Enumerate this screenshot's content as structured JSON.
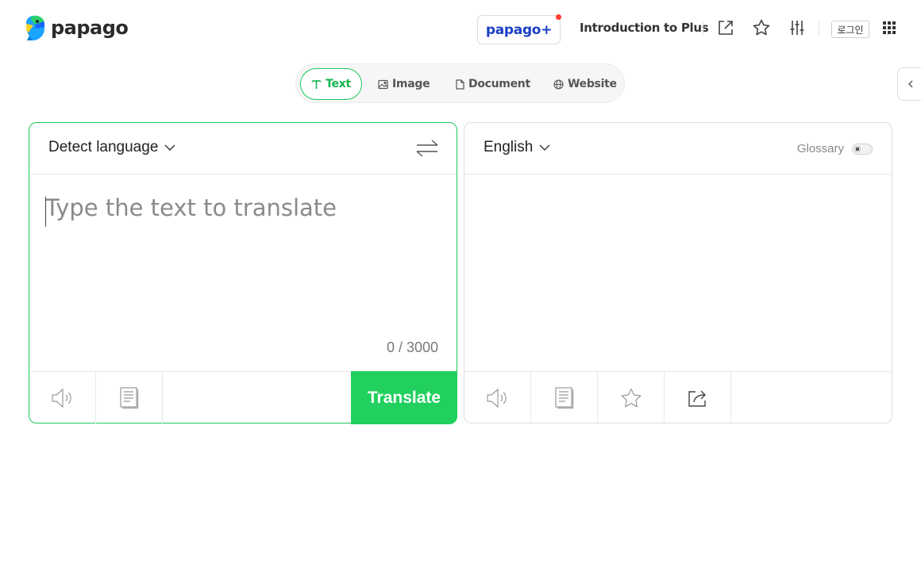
{
  "header": {
    "brand": "papago",
    "plus_label": "papago+",
    "intro_label": "Introduction to Plus",
    "login_label": "로그인",
    "icons": [
      "external-link-icon",
      "star-icon",
      "settings-sliders-icon",
      "apps-grid-icon"
    ]
  },
  "tabs": [
    {
      "label": "Text",
      "icon": "text-icon",
      "active": true
    },
    {
      "label": "Image",
      "icon": "image-icon",
      "active": false
    },
    {
      "label": "Document",
      "icon": "document-icon",
      "active": false
    },
    {
      "label": "Website",
      "icon": "globe-icon",
      "active": false
    }
  ],
  "source": {
    "language": "Detect language",
    "placeholder": "Type the text to translate",
    "value": "",
    "char_count": "0 / 3000",
    "translate_label": "Translate"
  },
  "target": {
    "language": "English",
    "glossary_label": "Glossary",
    "glossary_enabled": false
  },
  "colors": {
    "accent_green": "#21d05e",
    "plus_blue": "#1a3fc4",
    "notification_red": "#ff3b30"
  }
}
